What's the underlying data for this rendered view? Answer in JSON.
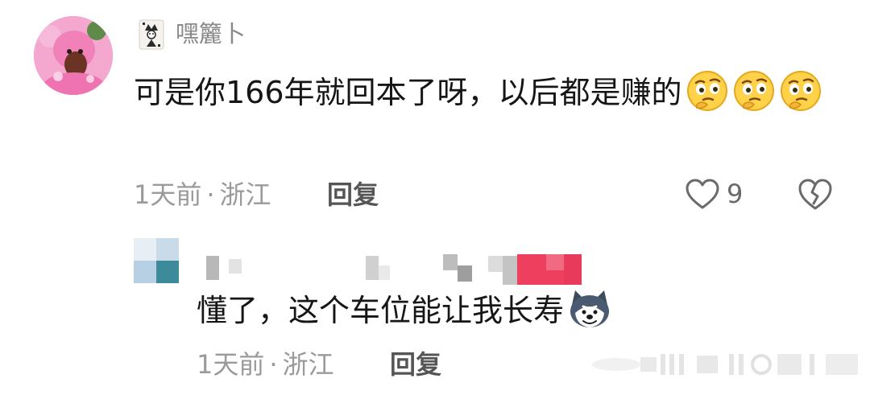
{
  "comment": {
    "username": "嘿籭卜",
    "text": "可是你166年就回本了呀，以后都是赚的",
    "emoji_icon": "thinking-face-emoji",
    "emoji_count": 3,
    "time": "1天前",
    "location": "浙江",
    "separator": "·",
    "reply_label": "回复",
    "like_count": "9",
    "like_icon": "heart-outline-icon",
    "dislike_icon": "broken-heart-icon"
  },
  "reply": {
    "username_blurred": true,
    "text": "懂了，这个车位能让我长寿",
    "emoji_icon": "husky-dog-emoji",
    "time": "1天前",
    "location": "浙江",
    "separator": "·",
    "reply_label": "回复"
  },
  "colors": {
    "text_primary": "#161616",
    "text_meta": "#9a9a9a",
    "mosaic_pink": "#ef3f5f"
  }
}
